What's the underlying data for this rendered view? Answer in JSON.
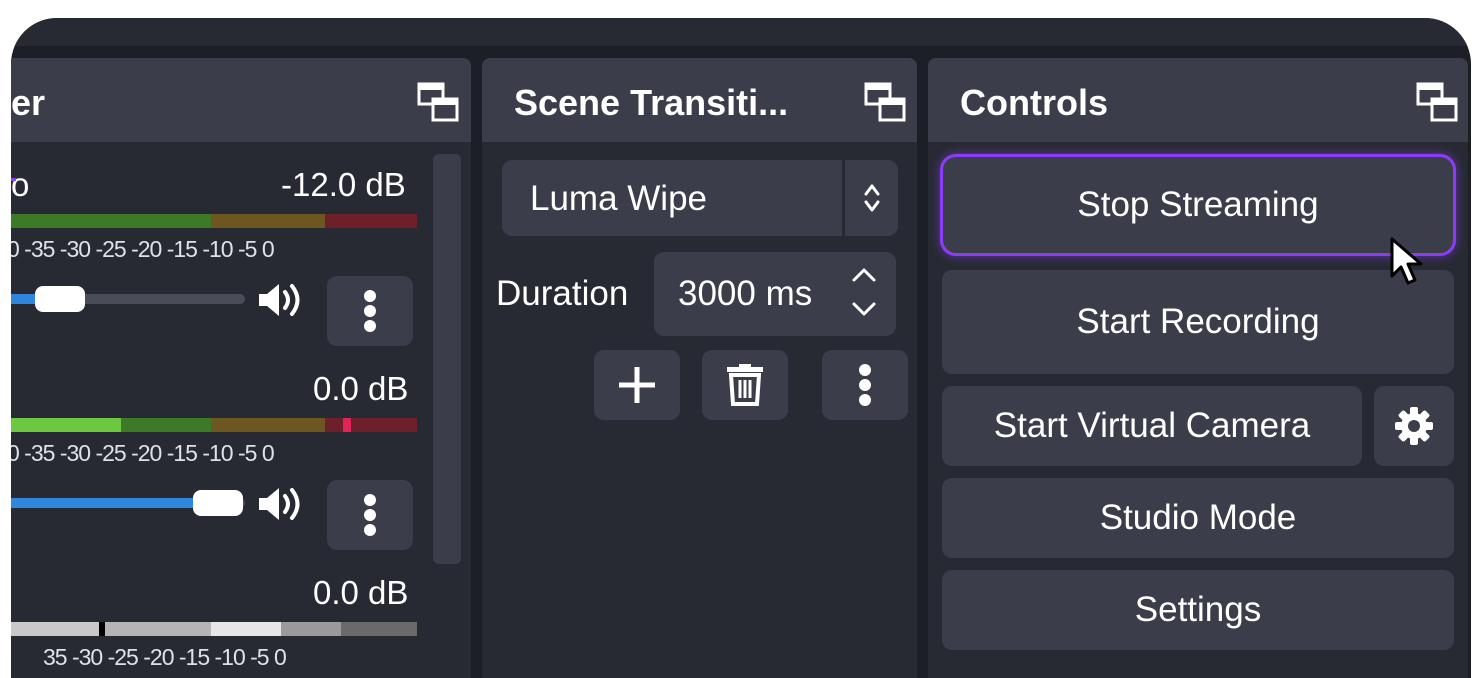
{
  "mixer": {
    "title_fragment": "er",
    "channels": [
      {
        "label_fragment": "o",
        "db": "-12.0 dB",
        "ticks": "0 -35 -30 -25 -20 -15 -10 -5 0"
      },
      {
        "label_fragment": "",
        "db": "0.0 dB",
        "ticks": "0 -35 -30 -25 -20 -15 -10 -5 0"
      },
      {
        "label_fragment": "",
        "db": "0.0 dB",
        "ticks": "35 -30 -25 -20 -15 -10 -5 0"
      }
    ],
    "volume_levels": [
      0.1,
      0.82
    ]
  },
  "transitions": {
    "title": "Scene Transiti...",
    "selected": "Luma Wipe",
    "duration_label": "Duration",
    "duration_value": "3000 ms"
  },
  "controls": {
    "title": "Controls",
    "stop_streaming": "Stop Streaming",
    "start_recording": "Start Recording",
    "start_virtual_camera": "Start Virtual Camera",
    "studio_mode": "Studio Mode",
    "settings": "Settings"
  },
  "colors": {
    "accent": "#8b3df5",
    "meter_green": "#5fb53a",
    "meter_yellow": "#b88a2b",
    "meter_red": "#b3273a",
    "slider_blue": "#2f86de"
  }
}
